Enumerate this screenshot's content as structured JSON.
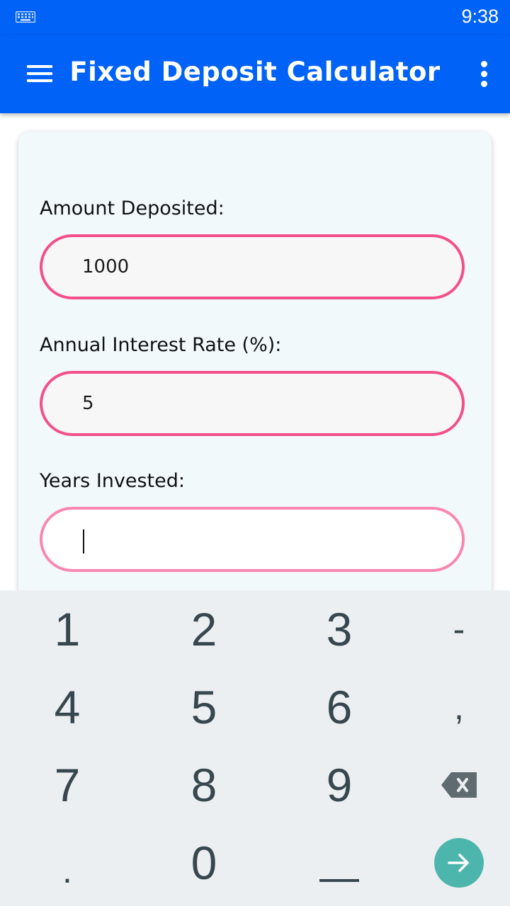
{
  "status_bar": {
    "time": "9:38",
    "left_icon": "keyboard-icon"
  },
  "app_bar": {
    "title": "Fixed Deposit Calculator",
    "menu_icon": "hamburger-menu-icon",
    "overflow_icon": "more-vert-icon",
    "background_color": "#0062f7"
  },
  "form": {
    "amount": {
      "label": "Amount Deposited:",
      "value": "1000"
    },
    "rate": {
      "label": "Annual Interest Rate (%):",
      "value": "5"
    },
    "years": {
      "label": "Years Invested:",
      "value": ""
    },
    "field_border_color": "#f34f8a"
  },
  "keyboard": {
    "rows": [
      [
        "1",
        "2",
        "3",
        "-"
      ],
      [
        "4",
        "5",
        "6",
        ","
      ],
      [
        "7",
        "8",
        "9",
        "backspace"
      ],
      [
        ".",
        "0",
        "space",
        "enter"
      ]
    ],
    "keys": {
      "k1": "1",
      "k2": "2",
      "k3": "3",
      "minus": "-",
      "k4": "4",
      "k5": "5",
      "k6": "6",
      "comma": ",",
      "k7": "7",
      "k8": "8",
      "k9": "9",
      "period": ".",
      "k0": "0"
    },
    "enter_color": "#4db6ac"
  }
}
